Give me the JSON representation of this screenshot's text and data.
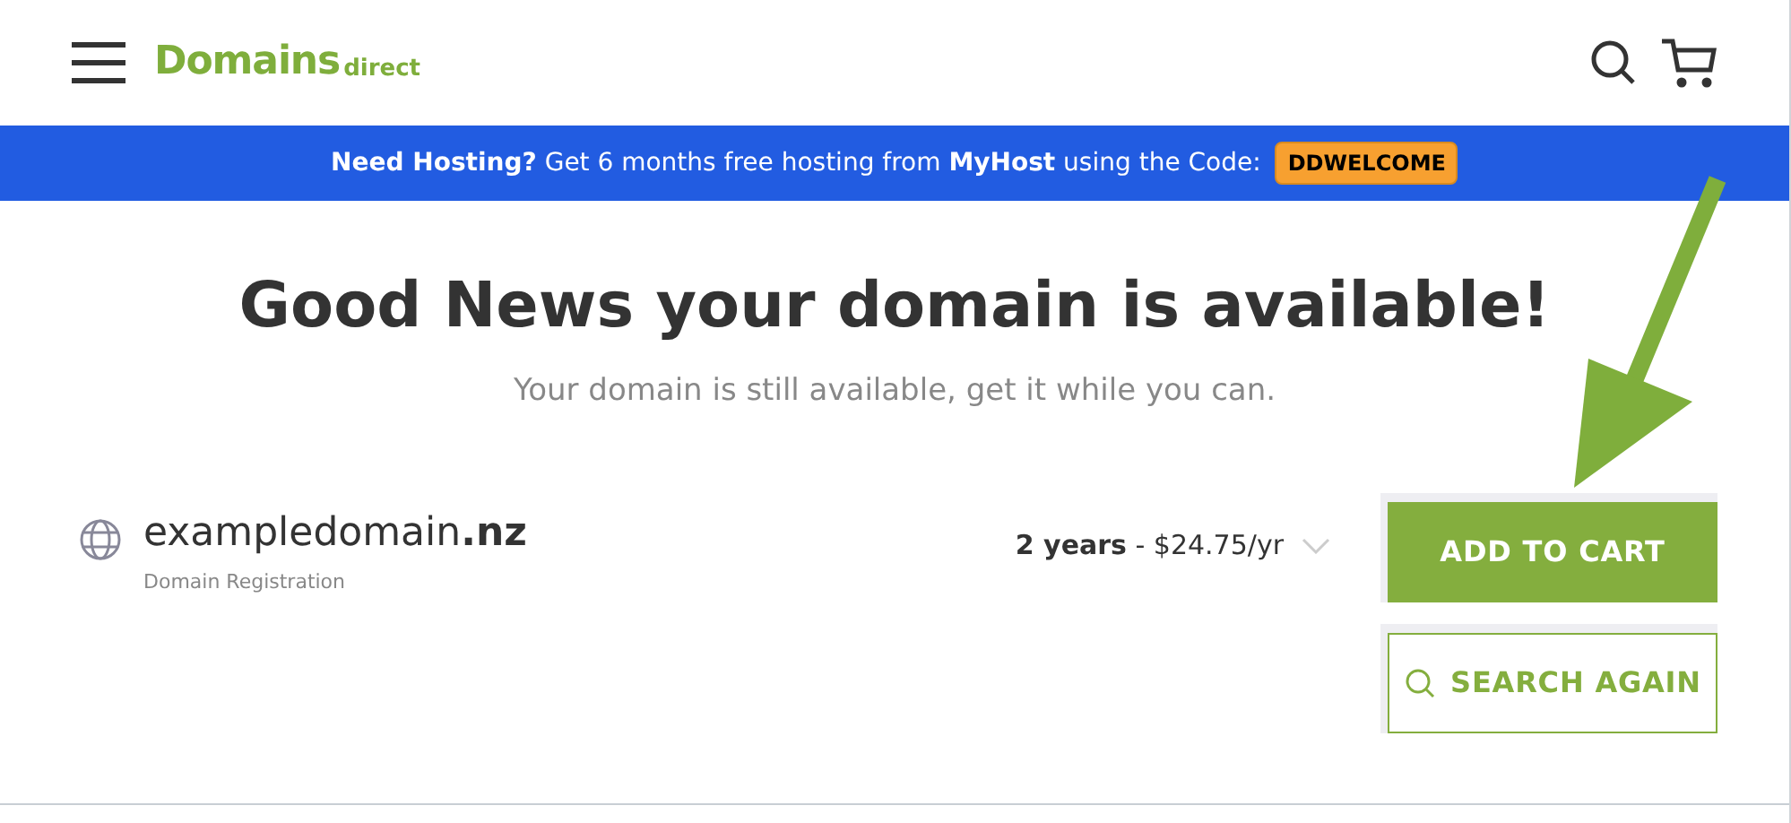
{
  "header": {
    "logo": {
      "main": "Domains",
      "sub": "direct"
    }
  },
  "banner": {
    "text": "**Need Hosting?** Get 6 months free hosting from **MyHost** using the Code:",
    "code": "DDWELCOME"
  },
  "heading": "Good News your domain is available!",
  "subheading": "Your domain is still available, get it while you can.",
  "result": {
    "domain": "exampledomain**.nz**",
    "type": "Domain Registration",
    "period": "**2 years** - $24.75/yr"
  },
  "buttons": [
    {
      "label": "ADD TO CART",
      "kind": "primary"
    },
    {
      "label": "SEARCH AGAIN",
      "kind": "outline"
    }
  ]
}
